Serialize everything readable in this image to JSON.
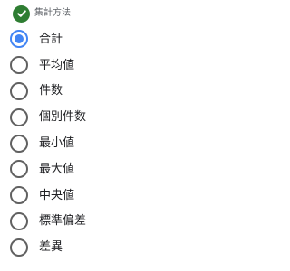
{
  "header": {
    "title": "集計方法",
    "icon": "check-circle-icon"
  },
  "aggregation": {
    "selected_index": 0,
    "options": [
      {
        "label": "合計",
        "key": "sum"
      },
      {
        "label": "平均値",
        "key": "average"
      },
      {
        "label": "件数",
        "key": "count"
      },
      {
        "label": "個別件数",
        "key": "distinct-count"
      },
      {
        "label": "最小値",
        "key": "min"
      },
      {
        "label": "最大値",
        "key": "max"
      },
      {
        "label": "中央値",
        "key": "median"
      },
      {
        "label": "標準偏差",
        "key": "std-dev"
      },
      {
        "label": "差異",
        "key": "variance"
      }
    ]
  },
  "colors": {
    "accent": "#4285f4",
    "check": "#2e7d32",
    "ring": "#616161",
    "muted": "#5f6368"
  }
}
